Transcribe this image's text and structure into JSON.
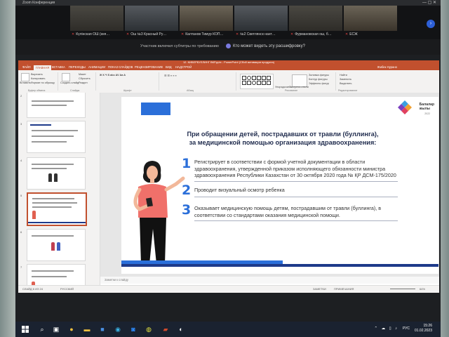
{
  "zoom": {
    "window_title": "Zoom Конференция",
    "participants": [
      "Күлінская ОШ (кня…",
      "Ош №3 Красный Ру…",
      "Калтанов Тимур КОП…",
      "№2 Светлянск нант…",
      "Фурмановская ош, б…",
      "ЕСЖ"
    ],
    "subtitles_notice": "Участник включил субтитры по требованию",
    "transcript_question": "Кто может видеть эту расшифровку?",
    "next_arrow": "›"
  },
  "powerpoint": {
    "title": "12. КИБЕРБУЛЛИНГ ВКР.pptx - PowerPoint (Сбой активации продукта)",
    "user_name": "Жибек Нурано",
    "tabs": [
      "ФАЙЛ",
      "ГЛАВНАЯ",
      "ВСТАВКА",
      "ПЕРЕХОДЫ",
      "АНИМАЦИИ",
      "ПОКАЗ СЛАЙДОВ",
      "РЕЦЕНЗИРОВАНИЕ",
      "ВИД",
      "НАДСТРОЙ"
    ],
    "active_tab": "ГЛАВНАЯ",
    "ribbon": {
      "paste": "Вставить",
      "cut": "Вырезать",
      "copy": "Копировать",
      "format_painter": "Формат по образцу",
      "new_slide": "Создать слайд",
      "layout": "Макет",
      "reset": "Сбросить",
      "section": "Раздел",
      "arrange": "Упорядочить",
      "quick_styles": "Экспресс-стили",
      "shape_fill": "Заливка фигуры",
      "shape_outline": "Контур фигуры",
      "shape_effects": "Эффекты фигур",
      "find": "Найти",
      "replace": "Заменить",
      "select": "Выделить",
      "groups": [
        "Буфер обмена",
        "Слайды",
        "Шрифт",
        "Абзац",
        "Рисование",
        "Редактирование"
      ]
    },
    "slide": {
      "logo_text_1": "Балалар",
      "logo_text_2": "жылы",
      "logo_year": "2022",
      "title_line1": "При обращении детей, пострадавших от травли (буллинга),",
      "title_line2": "за медицинской помощью организация здравоохранения:",
      "items": [
        {
          "num": "1",
          "text": "Регистрирует в соответствии с формой учетной документации в области здравоохранения, утвержденной приказом исполняющего обязанности министра здравоохранения Республики Казахстан от 30 октября 2020 года № ҚР ДСМ-175/2020"
        },
        {
          "num": "2",
          "text": "Проводит визуальный осмотр ребенка"
        },
        {
          "num": "3",
          "text": "Оказывает медицинскую помощь детям, пострадавшим от травли (буллинга), в соответствии со стандартами оказания медицинской помощи."
        }
      ]
    },
    "notes_placeholder": "Заметки к слайду",
    "status": {
      "slide_info": "СЛАЙД 6 ИЗ 24",
      "language": "РУССКИЙ",
      "notes": "ЗАМЕТКИ",
      "comments": "ПРИМЕЧАНИЯ",
      "zoom": "64%"
    },
    "thumb_numbers": [
      "1",
      "2",
      "3",
      "4",
      "5",
      "6",
      "7",
      "8"
    ]
  },
  "taskbar": {
    "start_icon": "windows-icon",
    "lang": "РУС",
    "time": "15:26",
    "date": "01.02.2023"
  }
}
